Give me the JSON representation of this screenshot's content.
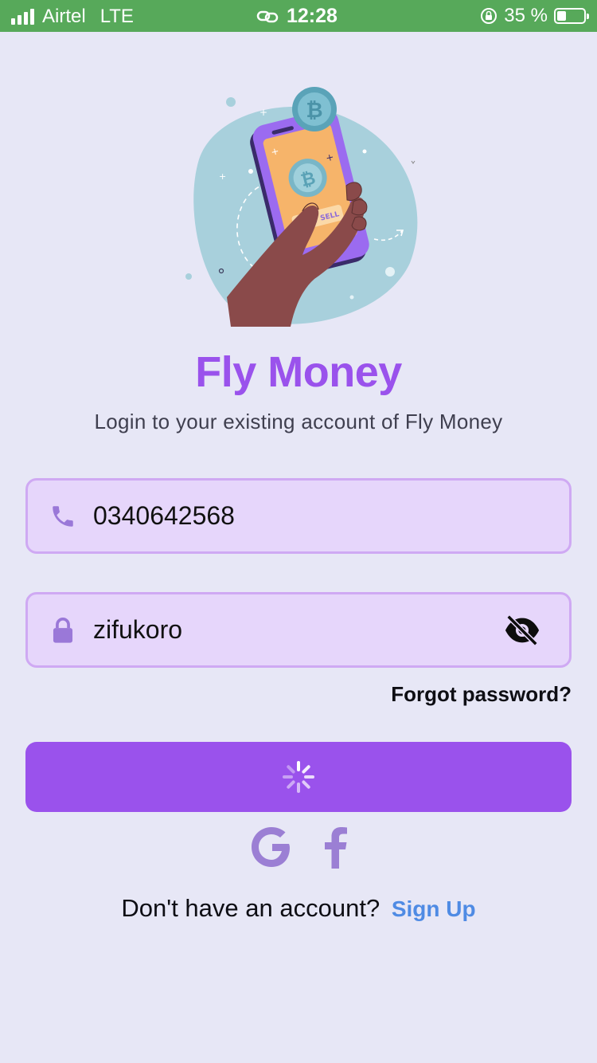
{
  "status_bar": {
    "carrier": "Airtel",
    "network": "LTE",
    "time": "12:28",
    "battery_percent": "35 %",
    "battery_level": 0.35,
    "background_color": "#57a95a"
  },
  "hero": {
    "icons": [
      "phone-illustration",
      "bitcoin-coin",
      "hand"
    ],
    "button_text": "BUY / SELL"
  },
  "title": "Fly Money",
  "subtitle": "Login to your existing account of Fly Money",
  "phone_field": {
    "icon": "phone-icon",
    "value": "0340642568"
  },
  "password_field": {
    "icon": "lock-icon",
    "value": "zifukoro",
    "toggle_icon": "eye-off-icon"
  },
  "forgot_password": "Forgot password?",
  "login_button": {
    "state": "loading",
    "icon": "spinner-icon",
    "color": "#9a52ec"
  },
  "social": {
    "google_icon": "google-icon",
    "facebook_icon": "facebook-icon",
    "color": "#9b7fd4"
  },
  "signup": {
    "prompt": "Don't have an account?",
    "link": "Sign Up",
    "link_color": "#4f8be4"
  }
}
